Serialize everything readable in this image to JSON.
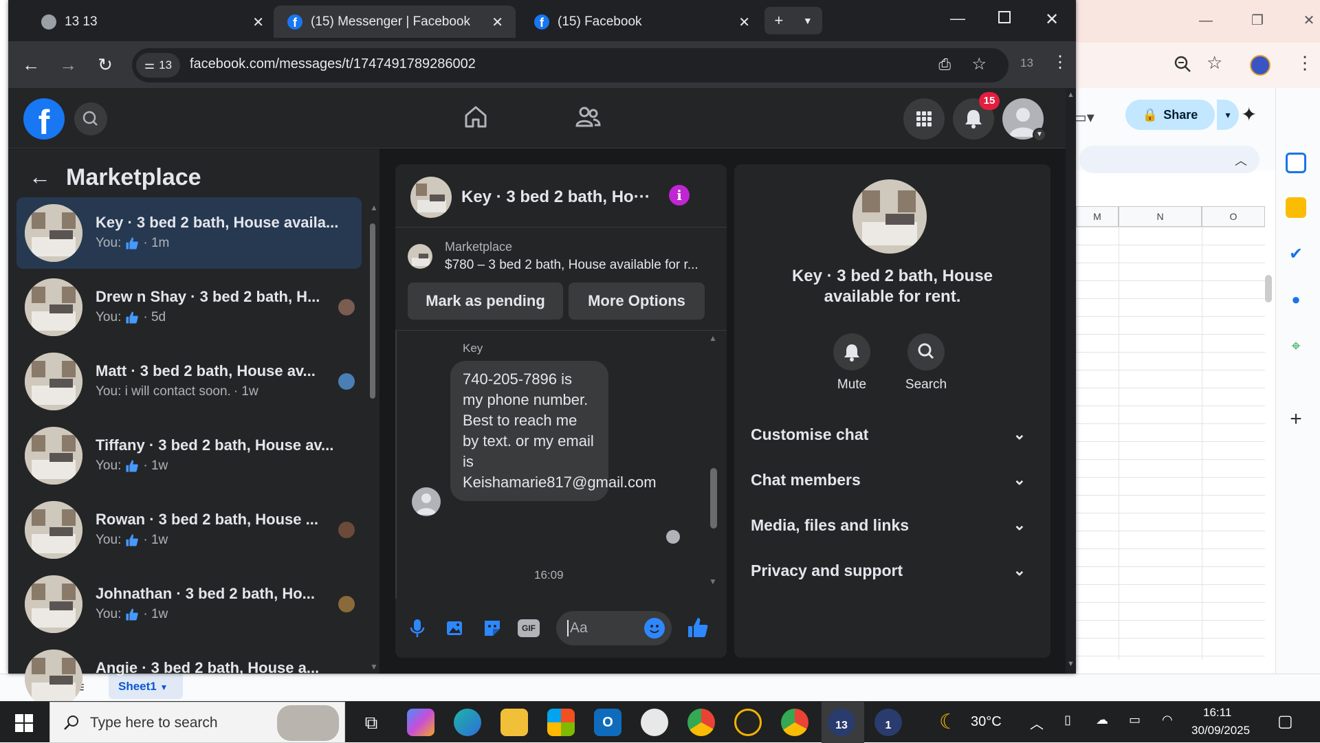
{
  "sheets": {
    "share_label": "Share",
    "columns": [
      "M",
      "N",
      "O"
    ],
    "sheet_tab": "Sheet1"
  },
  "browser": {
    "tabs": [
      {
        "title": "13 13"
      },
      {
        "title": "(15) Messenger | Facebook"
      },
      {
        "title": "(15) Facebook"
      }
    ],
    "site_info_badge": "13",
    "url": "facebook.com/messages/t/1747491789286002",
    "extension_count": "13"
  },
  "facebook": {
    "notification_count": "15",
    "left_title": "Marketplace",
    "conversations": [
      {
        "name": "Key · 3 bed 2 bath, House availa...",
        "preview": "You:",
        "time": "· 1m",
        "has_like": true,
        "selected": true
      },
      {
        "name": "Drew n Shay · 3 bed 2 bath, H...",
        "preview": "You:",
        "time": "· 5d",
        "has_like": true
      },
      {
        "name": "Matt · 3 bed 2 bath, House av...",
        "preview": "You: i will contact soon.",
        "time": "· 1w",
        "has_like": false
      },
      {
        "name": "Tiffany · 3 bed 2 bath, House av...",
        "preview": "You:",
        "time": "· 1w",
        "has_like": true
      },
      {
        "name": "Rowan · 3 bed 2 bath, House ...",
        "preview": "You:",
        "time": "· 1w",
        "has_like": true
      },
      {
        "name": "Johnathan · 3 bed 2 bath, Ho...",
        "preview": "You:",
        "time": "· 1w",
        "has_like": true
      },
      {
        "name": "Angie · 3 bed 2 bath, House a...",
        "preview": "",
        "time": "",
        "has_like": false
      }
    ],
    "chat": {
      "title": "Key · 3 bed 2 bath, Ho···",
      "listing_source": "Marketplace",
      "listing_desc": "$780 – 3 bed 2 bath, House available for r...",
      "mark_pending": "Mark as pending",
      "more_options": "More Options",
      "sender": "Key",
      "message": "740-205-7896 is my phone number. Best to reach me by text. or my email is Keishamarie817@gmail.com",
      "timestamp": "16:09",
      "composer_placeholder": "Aa"
    },
    "info": {
      "title": "Key · 3 bed 2 bath, House available for rent.",
      "mute": "Mute",
      "search": "Search",
      "items": [
        "Customise chat",
        "Chat members",
        "Media, files and links",
        "Privacy and support"
      ]
    }
  },
  "taskbar": {
    "search_placeholder": "Type here to search",
    "temperature": "30°C",
    "time": "16:11",
    "date": "30/09/2025",
    "badge_a": "13",
    "badge_b": "1"
  }
}
